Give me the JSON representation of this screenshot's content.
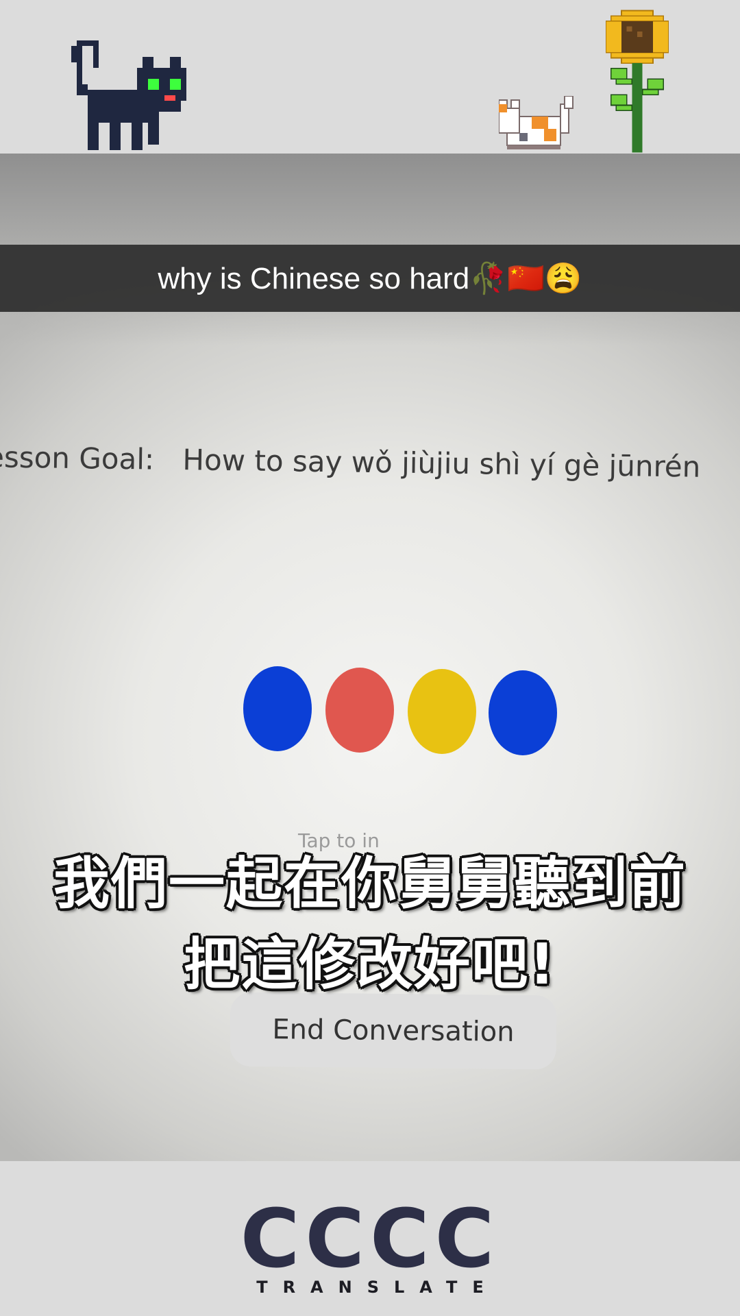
{
  "caption": {
    "text": "why is Chinese so hard🥀🇨🇳😩"
  },
  "lesson": {
    "label": "esson Goal:",
    "goal": "How to say wǒ jiùjiu shì yí gè jūnrén"
  },
  "voice_dots": {
    "colors": [
      "#0b3fd6",
      "#e0574f",
      "#e8c212",
      "#0b3fd6"
    ]
  },
  "tap_hint": {
    "text": "Tap to in"
  },
  "end_button": {
    "label": "End Conversation"
  },
  "subtitles": {
    "line1": "我們一起在你舅舅聽到前",
    "line2": "把這修改好吧!"
  },
  "decor": {
    "icons": [
      "black-cat-icon",
      "calico-cat-icon",
      "sunflower-icon"
    ]
  },
  "logo": {
    "mark": "CCCC",
    "subtitle": "TRANSLATE",
    "color": "#2d2f47"
  }
}
